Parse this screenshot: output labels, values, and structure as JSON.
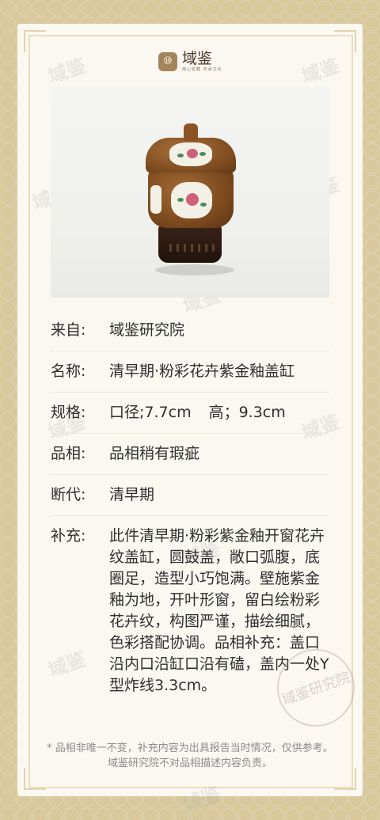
{
  "logo": {
    "mark": "⑩",
    "name": "域鉴",
    "sub": "用心收藏 传承文化"
  },
  "watermark": "域鉴",
  "rows": {
    "from": {
      "label": "来自:",
      "value": "域鉴研究院"
    },
    "name": {
      "label": "名称:",
      "value": "清早期·粉彩花卉紫金釉盖缸"
    },
    "spec": {
      "label": "规格:",
      "value_a": "口径;7.7cm",
      "value_b": "高；9.3cm"
    },
    "condition": {
      "label": "品相:",
      "value": "品相稍有瑕疵"
    },
    "dating": {
      "label": "断代:",
      "value": "清早期"
    },
    "supplement": {
      "label": "补充:",
      "value": "此件清早期·粉彩紫金釉开窗花卉纹盖缸，圆鼓盖，敞口弧腹，底圈足，造型小巧饱满。壁施紫金釉为地，开叶形窗，留白绘粉彩花卉纹，构图严谨，描绘细腻，色彩搭配协调。品相补充：盖口沿内口沿缸口沿有磕，盖内一处Y型炸线3.3cm。"
    }
  },
  "footnote": "* 品相非唯一不变，补充内容为出具报告当时情况，仅供参考。域鉴研究院不对品相描述内容负责。",
  "seal": "域鉴研究院"
}
